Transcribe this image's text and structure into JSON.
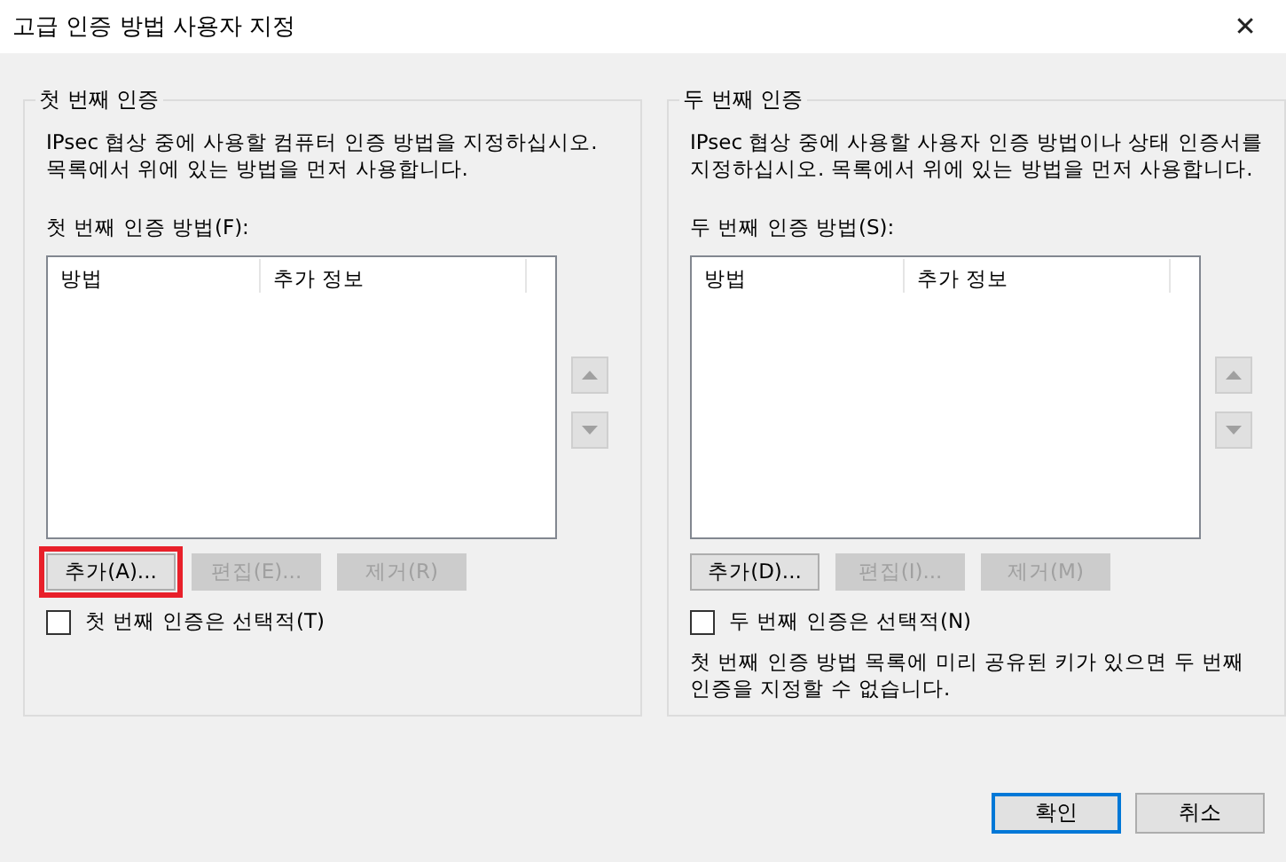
{
  "window": {
    "title": "고급 인증 방법 사용자 지정",
    "close": "✕"
  },
  "groups": [
    {
      "title": "첫 번째 인증",
      "description": "IPsec 협상 중에 사용할 컴퓨터 인증 방법을 지정하십시오. 목록에서 위에 있는 방법을 먼저 사용합니다.",
      "list_label": "첫 번째 인증 방법(F):",
      "columns": [
        "방법",
        "추가 정보"
      ],
      "move_up_disabled": true,
      "move_down_disabled": true,
      "buttons": [
        {
          "label": "추가(A)...",
          "disabled": false,
          "highlighted": true
        },
        {
          "label": "편집(E)...",
          "disabled": true,
          "highlighted": false
        },
        {
          "label": "제거(R)",
          "disabled": true,
          "highlighted": false
        }
      ],
      "optional": {
        "label": "첫 번째 인증은 선택적(T)",
        "checked": false
      }
    },
    {
      "title": "두 번째 인증",
      "description": "IPsec 협상 중에 사용할 사용자 인증 방법이나 상태 인증서를 지정하십시오. 목록에서 위에 있는 방법을 먼저 사용합니다.",
      "list_label": "두 번째 인증 방법(S):",
      "columns": [
        "방법",
        "추가 정보"
      ],
      "move_up_disabled": true,
      "move_down_disabled": true,
      "buttons": [
        {
          "label": "추가(D)...",
          "disabled": false,
          "highlighted": false
        },
        {
          "label": "편집(I)...",
          "disabled": true,
          "highlighted": false
        },
        {
          "label": "제거(M)",
          "disabled": true,
          "highlighted": false
        }
      ],
      "optional": {
        "label": "두 번째 인증은 선택적(N)",
        "checked": false
      },
      "note": "첫 번째 인증 방법 목록에 미리 공유된 키가 있으면 두 번째 인증을 지정할 수 없습니다."
    }
  ],
  "footer": [
    {
      "label": "확인",
      "default": true
    },
    {
      "label": "취소",
      "default": false
    }
  ]
}
